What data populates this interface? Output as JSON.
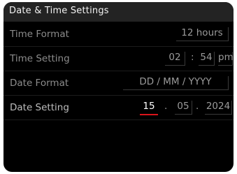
{
  "header": {
    "title": "Date & Time Settings"
  },
  "rows": {
    "time_format": {
      "label": "Time Format",
      "value": "12 hours"
    },
    "time_setting": {
      "label": "Time Setting",
      "hour": "02",
      "separator": ":",
      "minute": "54",
      "ampm": "pm"
    },
    "date_format": {
      "label": "Date Format",
      "value": "DD / MM / YYYY"
    },
    "date_setting": {
      "label": "Date Setting",
      "day": "15",
      "month": "05",
      "year": "2024",
      "separator": "."
    }
  },
  "colors": {
    "background": "#000000",
    "title_bar": "#232323",
    "accent_underline": "#d9141b"
  }
}
